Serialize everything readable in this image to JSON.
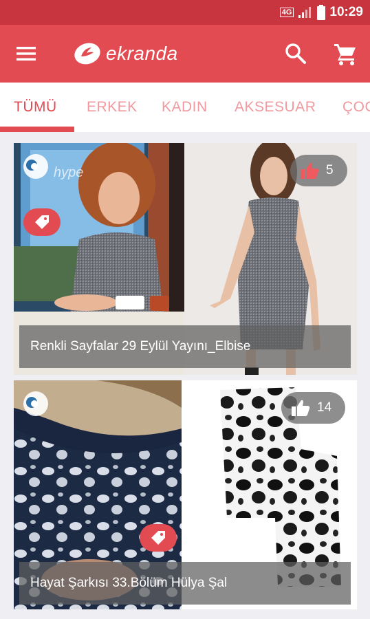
{
  "status_bar": {
    "network": "4G",
    "time": "10:29"
  },
  "app_bar": {
    "brand": "ekranda",
    "menu_icon": "menu-icon",
    "search_icon": "search-icon",
    "cart_icon": "cart-icon"
  },
  "tabs": [
    {
      "label": "TÜMÜ",
      "active": true
    },
    {
      "label": "ERKEK",
      "active": false
    },
    {
      "label": "KADIN",
      "active": false
    },
    {
      "label": "AKSESUAR",
      "active": false
    },
    {
      "label": "ÇOC",
      "active": false
    }
  ],
  "cards": [
    {
      "title": "Renkli Sayfalar 29 Eylül Yayını_Elbise",
      "likes": "5",
      "like_icon": "thumbs-up-icon",
      "channel_logo": "channel-logo",
      "channel_watermark": "hype",
      "product": "tweed-dress"
    },
    {
      "title": "Hayat Şarkısı 33.Bölüm Hülya Şal",
      "likes": "14",
      "like_icon": "thumbs-up-icon",
      "channel_logo": "channel-logo",
      "product": "floral-scarf"
    }
  ],
  "colors": {
    "status_bar": "#c8353e",
    "primary": "#e34b53",
    "tab_inactive": "#f09aa0",
    "background": "#efeef2"
  }
}
